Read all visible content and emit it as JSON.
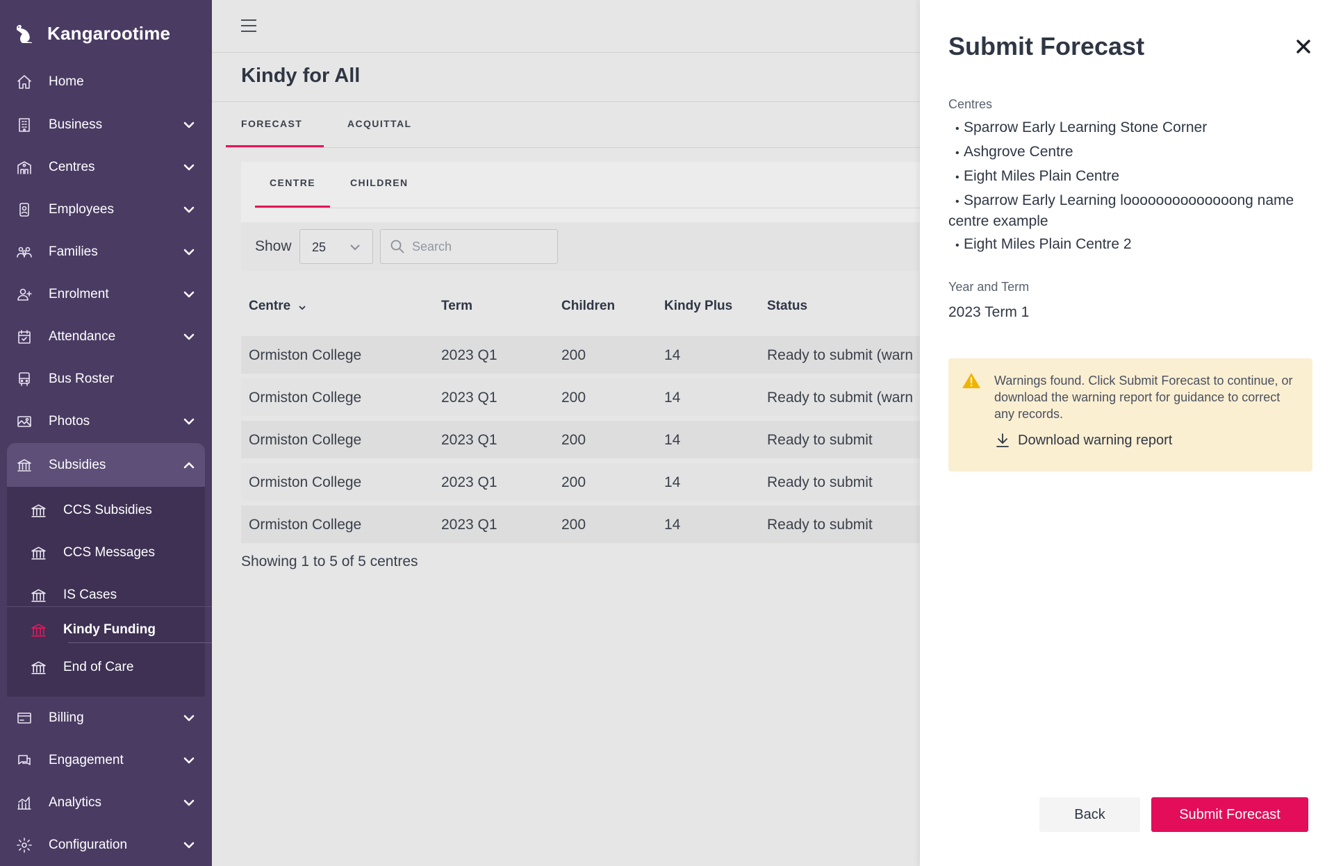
{
  "brand": {
    "name": "Kangarootime"
  },
  "sidebar": {
    "items": [
      {
        "label": "Home",
        "icon": "home-icon",
        "expandable": false
      },
      {
        "label": "Business",
        "icon": "building-icon",
        "expandable": true
      },
      {
        "label": "Centres",
        "icon": "centre-icon",
        "expandable": true
      },
      {
        "label": "Employees",
        "icon": "id-badge-icon",
        "expandable": true
      },
      {
        "label": "Families",
        "icon": "family-icon",
        "expandable": true
      },
      {
        "label": "Enrolment",
        "icon": "add-user-icon",
        "expandable": true
      },
      {
        "label": "Attendance",
        "icon": "calendar-check-icon",
        "expandable": true
      },
      {
        "label": "Bus Roster",
        "icon": "bus-icon",
        "expandable": false
      },
      {
        "label": "Photos",
        "icon": "image-icon",
        "expandable": true
      },
      {
        "label": "Subsidies",
        "icon": "bank-icon",
        "expandable": true,
        "expanded": true
      },
      {
        "label": "Billing",
        "icon": "credit-card-icon",
        "expandable": true
      },
      {
        "label": "Engagement",
        "icon": "chat-icon",
        "expandable": true
      },
      {
        "label": "Analytics",
        "icon": "analytics-icon",
        "expandable": true
      },
      {
        "label": "Configuration",
        "icon": "gear-icon",
        "expandable": true
      }
    ],
    "subsidies_children": [
      {
        "label": "CCS Subsidies"
      },
      {
        "label": "CCS Messages"
      },
      {
        "label": "IS Cases"
      },
      {
        "label": "Kindy Funding",
        "current": true
      },
      {
        "label": "End of Care"
      }
    ]
  },
  "page": {
    "title": "Kindy for All",
    "tabs": [
      "FORECAST",
      "ACQUITTAL"
    ],
    "active_tab": "FORECAST",
    "subtabs": [
      "CENTRE",
      "CHILDREN"
    ],
    "active_subtab": "CENTRE"
  },
  "filters": {
    "show_label": "Show",
    "page_size": "25",
    "search_placeholder": "Search"
  },
  "table": {
    "columns": [
      "Centre",
      "Term",
      "Children",
      "Kindy Plus",
      "Status"
    ],
    "rows": [
      [
        "Ormiston College",
        "2023 Q1",
        "200",
        "14",
        "Ready to submit (warn"
      ],
      [
        "Ormiston College",
        "2023 Q1",
        "200",
        "14",
        "Ready to submit (warn"
      ],
      [
        "Ormiston College",
        "2023 Q1",
        "200",
        "14",
        "Ready to submit"
      ],
      [
        "Ormiston College",
        "2023 Q1",
        "200",
        "14",
        "Ready to submit"
      ],
      [
        "Ormiston College",
        "2023 Q1",
        "200",
        "14",
        "Ready to submit"
      ]
    ],
    "footer": "Showing 1 to 5 of 5 centres"
  },
  "drawer": {
    "title": "Submit Forecast",
    "centres_label": "Centres",
    "centres": [
      "Sparrow Early Learning Stone Corner",
      "Ashgrove Centre",
      "Eight Miles Plain Centre",
      "Sparrow Early Learning loooooooooooooong name centre example",
      "Eight Miles Plain Centre 2"
    ],
    "term_label": "Year and Term",
    "term_value": "2023 Term 1",
    "warning_text": "Warnings found. Click Submit Forecast to continue, or download the warning report for guidance to correct any records.",
    "download_label": "Download warning report",
    "back_label": "Back",
    "submit_label": "Submit Forecast"
  },
  "colors": {
    "sidebar_bg": "#4a3b63",
    "accent": "#e30d5a",
    "warning_bg": "#fbefd2",
    "warning_icon": "#f0b400"
  }
}
